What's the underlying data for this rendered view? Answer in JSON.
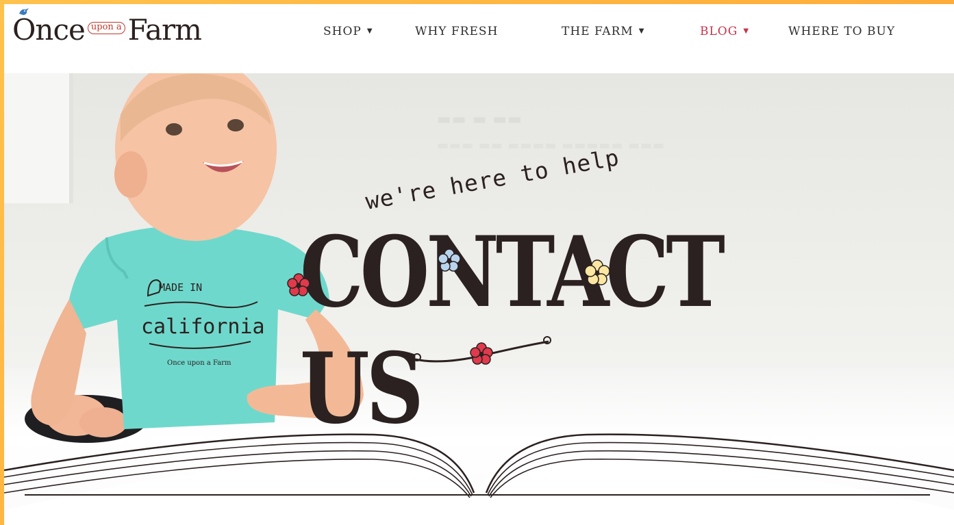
{
  "brand": {
    "logo_main_left": "Once",
    "logo_small": "upon a",
    "logo_main_right": "Farm"
  },
  "nav": {
    "items": [
      {
        "label": "SHOP",
        "has_dropdown": true,
        "active": false
      },
      {
        "label": "WHY FRESH",
        "has_dropdown": false,
        "active": false
      },
      {
        "label": "THE FARM",
        "has_dropdown": true,
        "active": false
      },
      {
        "label": "BLOG",
        "has_dropdown": true,
        "active": true
      },
      {
        "label": "WHERE TO BUY",
        "has_dropdown": false,
        "active": false
      }
    ],
    "caret": "▼"
  },
  "hero": {
    "tagline": "we're here to help",
    "title": "CONTACT US",
    "onesie_line1": "MADE IN",
    "onesie_line2": "california",
    "onesie_brand": "Once upon a Farm"
  },
  "colors": {
    "accent_red": "#c8334a",
    "ink": "#2b2120",
    "onesie": "#6fd8cc",
    "frame_orange": "#ffb347"
  }
}
